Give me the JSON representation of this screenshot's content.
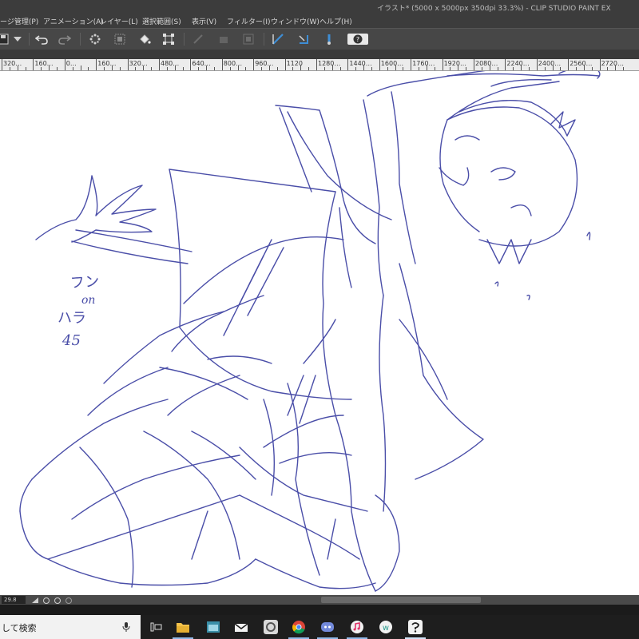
{
  "window": {
    "title": "イラスト* (5000 x 5000px 350dpi 33.3%) - CLIP STUDIO PAINT EX"
  },
  "menu": [
    "ージ管理(P)",
    "アニメーション(A)",
    "レイヤー(L)",
    "選択範囲(S)",
    "表示(V)",
    "フィルター(I)",
    "ウィンドウ(W)",
    "ヘルプ(H)"
  ],
  "ruler": {
    "labels": [
      "320…",
      "160…",
      "0…",
      "160…",
      "320…",
      "480…",
      "640…",
      "800…",
      "960…",
      "1120",
      "1280…",
      "1440…",
      "1600…",
      "1760…",
      "1920…",
      "2080…",
      "2240…",
      "2400…",
      "2560…",
      "2720…"
    ]
  },
  "canvas": {
    "notes": [
      "フン",
      "on",
      "ハラ",
      "45"
    ],
    "stroke_color": "#4a4ea8"
  },
  "status": {
    "zoom": "29.8"
  },
  "taskbar": {
    "search_text": "して検索",
    "icons": [
      "microphone-icon",
      "task-view-icon",
      "file-explorer-icon",
      "window-app-icon",
      "mail-icon",
      "ring-app-icon",
      "chrome-icon",
      "discord-icon",
      "music-icon",
      "w-app-icon",
      "clip-studio-icon"
    ]
  },
  "colors": {
    "toolbar_bg": "#474747",
    "accent_blue": "#3e8ed6",
    "taskbar_bg": "#1e1e1e"
  }
}
